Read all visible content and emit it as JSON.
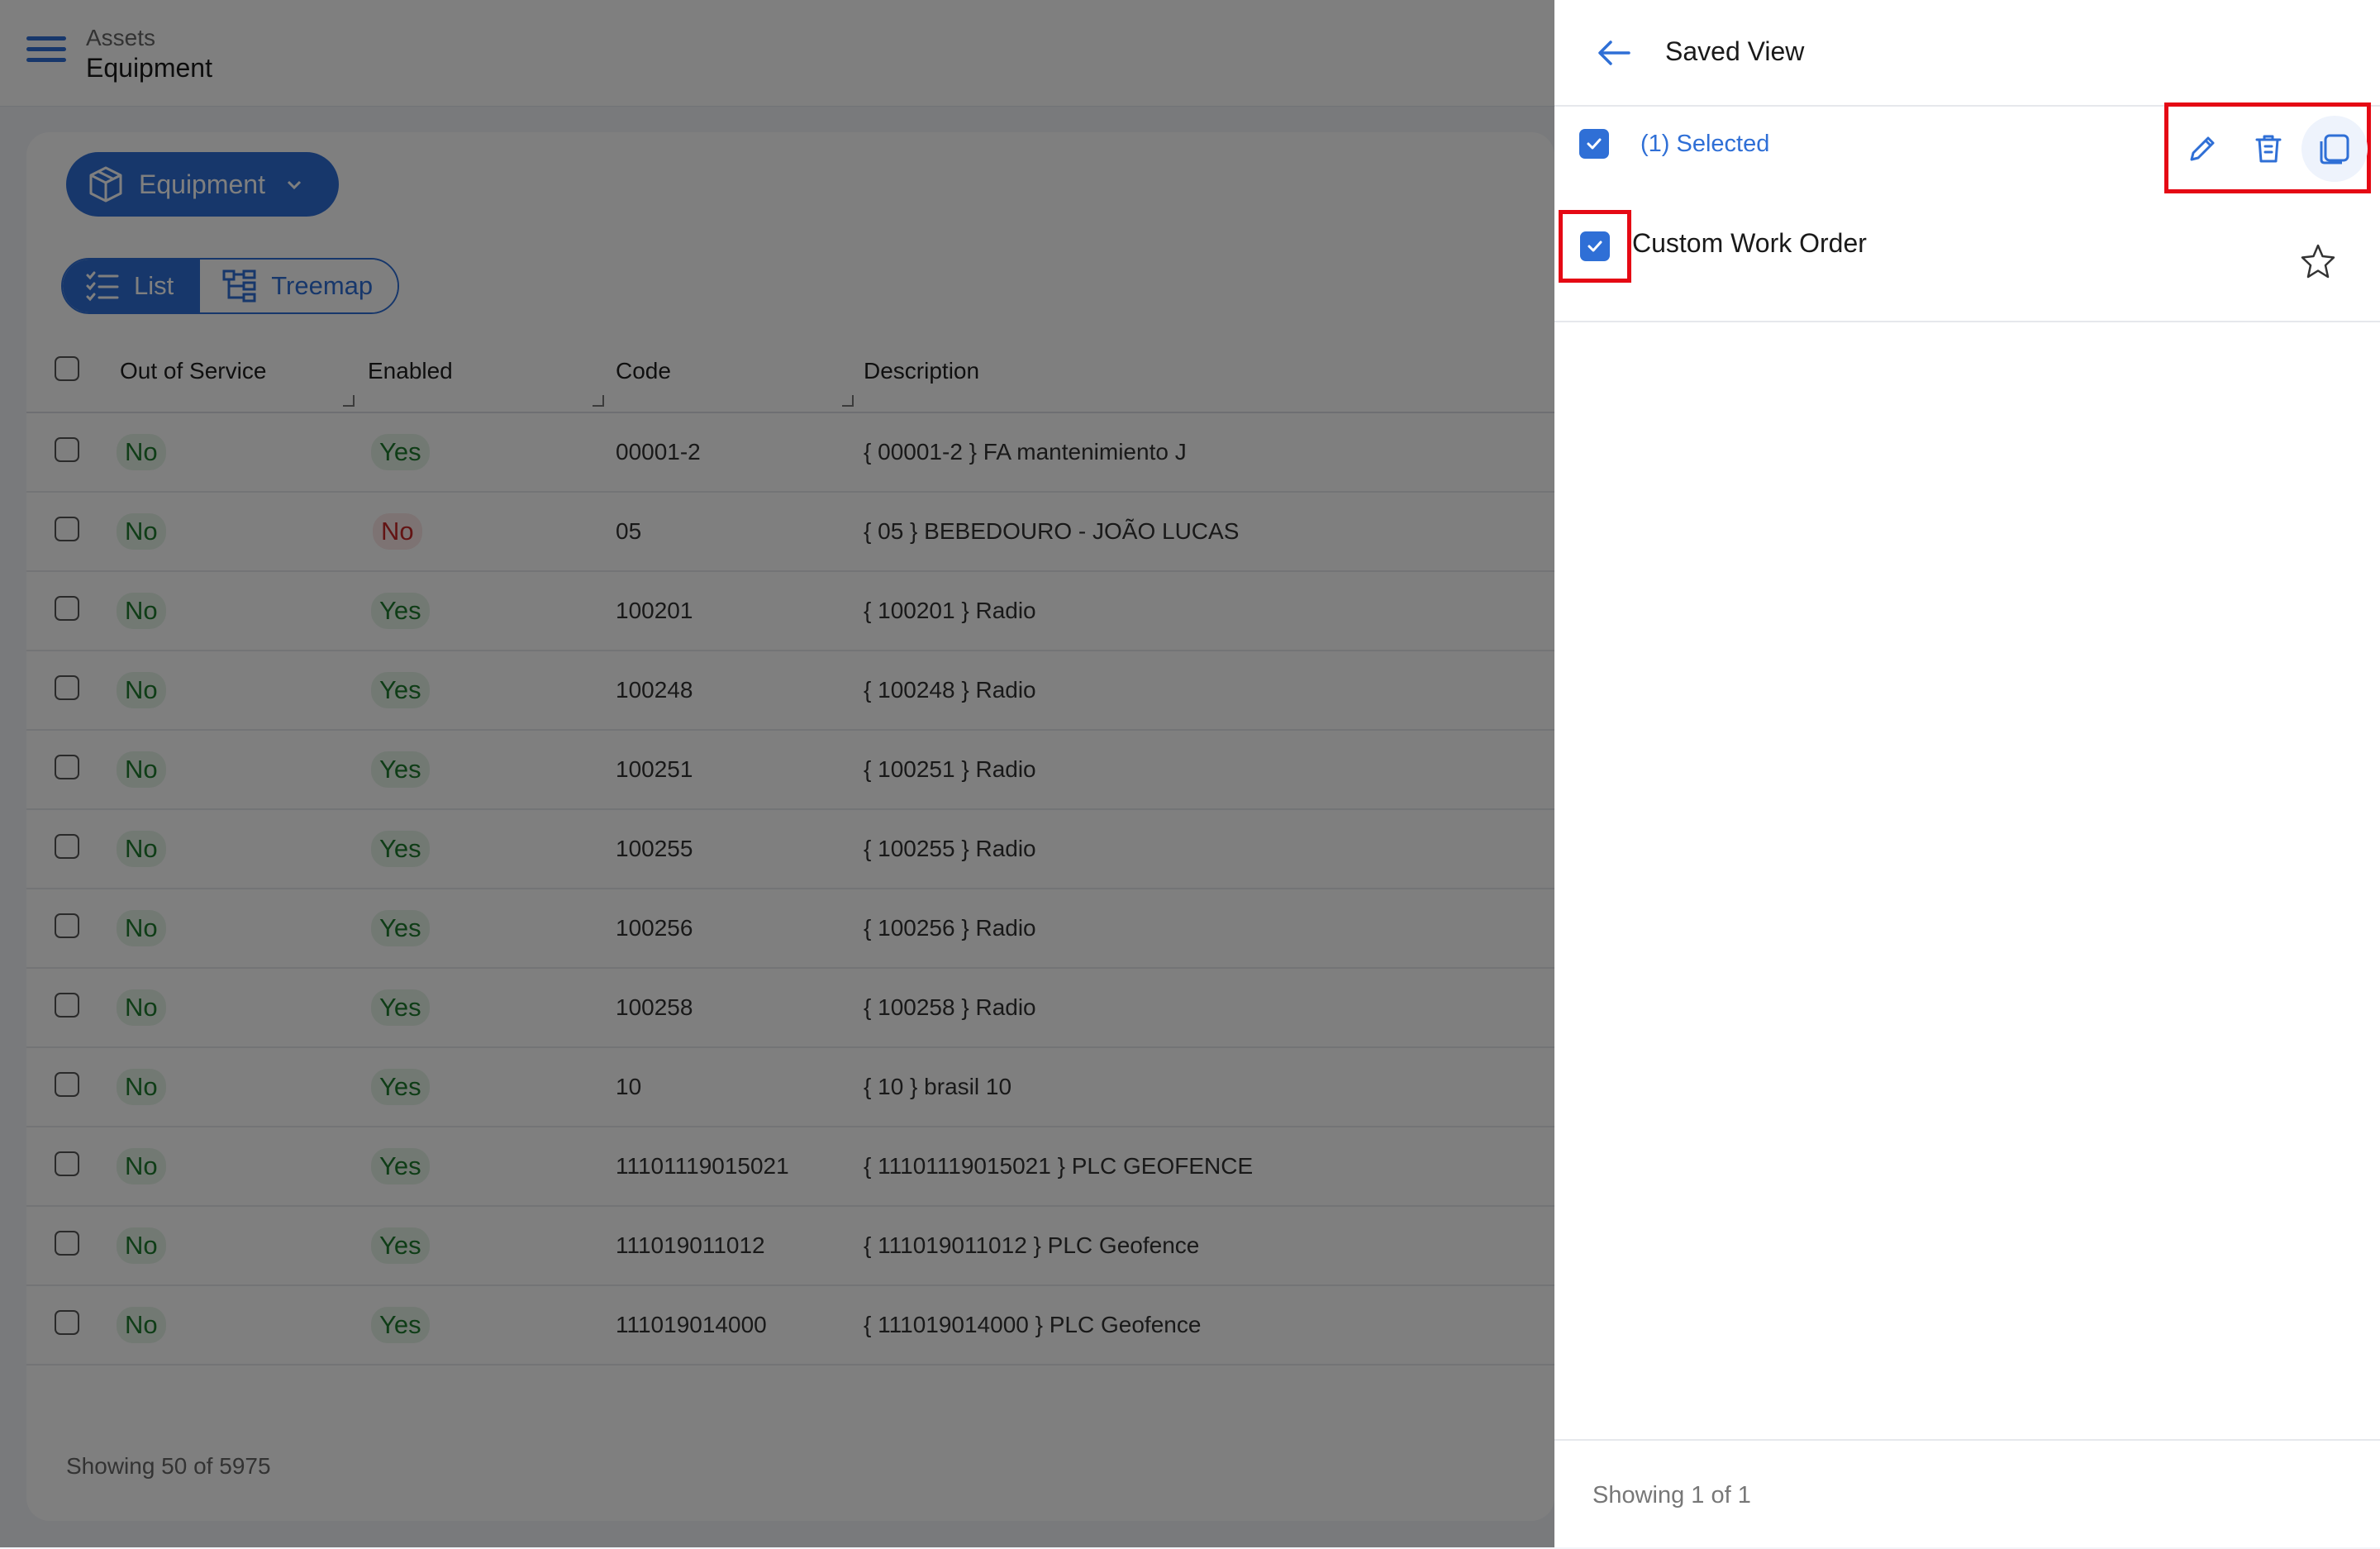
{
  "header": {
    "breadcrumb": "Assets",
    "title": "Equipment"
  },
  "filter": {
    "selector_label": "Equipment"
  },
  "view_tabs": [
    {
      "label": "List",
      "active": true
    },
    {
      "label": "Treemap",
      "active": false
    }
  ],
  "table": {
    "columns": [
      "Out of Service",
      "Enabled",
      "Code",
      "Description"
    ],
    "rows": [
      {
        "out_of_service": "No",
        "enabled": "Yes",
        "code": "00001-2",
        "description": "{ 00001-2 } FA mantenimiento J"
      },
      {
        "out_of_service": "No",
        "enabled": "No",
        "code": "05",
        "description": "{ 05 } BEBEDOURO - JOÃO LUCAS"
      },
      {
        "out_of_service": "No",
        "enabled": "Yes",
        "code": "100201",
        "description": "{ 100201 } Radio"
      },
      {
        "out_of_service": "No",
        "enabled": "Yes",
        "code": "100248",
        "description": "{ 100248 } Radio"
      },
      {
        "out_of_service": "No",
        "enabled": "Yes",
        "code": "100251",
        "description": "{ 100251 } Radio"
      },
      {
        "out_of_service": "No",
        "enabled": "Yes",
        "code": "100255",
        "description": "{ 100255 } Radio"
      },
      {
        "out_of_service": "No",
        "enabled": "Yes",
        "code": "100256",
        "description": "{ 100256 } Radio"
      },
      {
        "out_of_service": "No",
        "enabled": "Yes",
        "code": "100258",
        "description": "{ 100258 } Radio"
      },
      {
        "out_of_service": "No",
        "enabled": "Yes",
        "code": "10",
        "description": "{ 10 } brasil 10"
      },
      {
        "out_of_service": "No",
        "enabled": "Yes",
        "code": "11101119015021",
        "description": "{ 11101119015021 } PLC GEOFENCE"
      },
      {
        "out_of_service": "No",
        "enabled": "Yes",
        "code": "111019011012",
        "description": "{ 111019011012 } PLC Geofence"
      },
      {
        "out_of_service": "No",
        "enabled": "Yes",
        "code": "111019014000",
        "description": "{ 111019014000 } PLC Geofence"
      }
    ]
  },
  "list_footer": "Showing 50 of 5975",
  "panel": {
    "title": "Saved View",
    "selected_label": "(1) Selected",
    "actions": [
      "edit-icon",
      "trash-icon",
      "copy-icon"
    ],
    "items": [
      {
        "label": "Custom Work Order",
        "checked": true,
        "favorite": false
      }
    ],
    "footer": "Showing 1 of 1"
  },
  "colors": {
    "accent": "#2f6fd6",
    "highlight": "#e50914",
    "positive": "#1f7a2e",
    "negative": "#c62828"
  }
}
